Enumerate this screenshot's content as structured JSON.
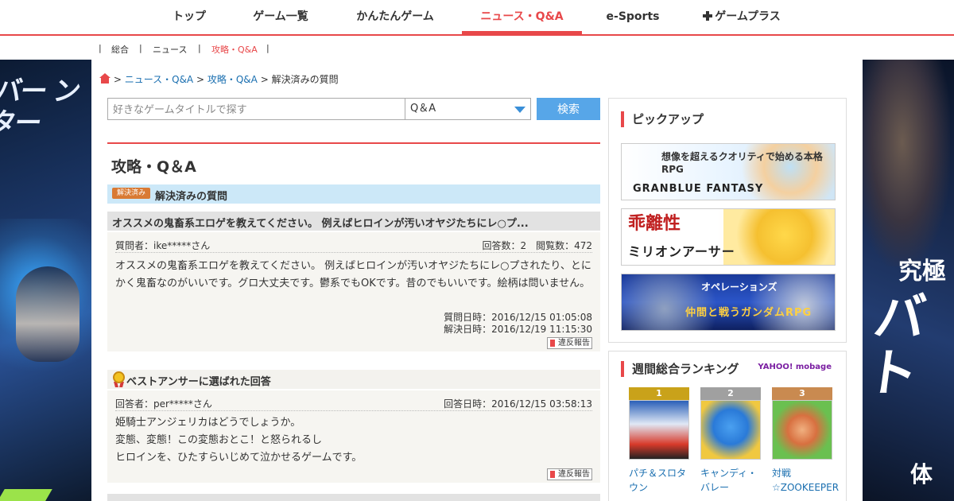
{
  "topnav": {
    "items": [
      "トップ",
      "ゲーム一覧",
      "かんたんゲーム",
      "ニュース・Q&A",
      "e-Sports",
      "ゲームプラス"
    ],
    "active_index": 3
  },
  "subnav": {
    "items": [
      "総合",
      "ニュース",
      "攻略・Q&A"
    ],
    "active_index": 2,
    "separator": "|"
  },
  "breadcrumb": {
    "sep": ">",
    "items": [
      "ニュース・Q&A",
      "攻略・Q&A",
      "解決済みの質問"
    ]
  },
  "search": {
    "placeholder": "好きなゲームタイトルで探す",
    "category_value": "Q＆A",
    "button_label": "検索"
  },
  "section_title": "攻略・Q＆A",
  "resolved": {
    "badge": "解決済み",
    "title": "解決済みの質問"
  },
  "question": {
    "title": "オススメの鬼畜系エロゲを教えてください。 例えばヒロインが汚いオヤジたちにレ○プ...",
    "asker": "質問者：ike*****さん",
    "counts": "回答数：2　閲覧数：472",
    "body": "オススメの鬼畜系エロゲを教えてください。 例えばヒロインが汚いオヤジたちにレ○プされたり、とにかく鬼畜なのがいいです。グロ大丈夫です。鬱系でもOKです。昔のでもいいです。絵柄は問いません。",
    "asked_at": "質問日時：2016/12/15 01:05:08",
    "resolved_at": "解決日時：2016/12/19 11:15:30",
    "report_label": "違反報告"
  },
  "best_answer": {
    "heading": "ベストアンサーに選ばれた回答",
    "answerer": "回答者：per*****さん",
    "answered_at": "回答日時：2016/12/15 03:58:13",
    "lines": [
      "姫騎士アンジェリカはどうでしょうか。",
      "変態、変態！この変態おとこ！と怒られるし",
      "ヒロインを、ひたすらいじめて泣かせるゲームです。"
    ],
    "report_label": "違反報告"
  },
  "pickup": {
    "heading": "ピックアップ",
    "banners": [
      {
        "text": "想像を超えるクオリティで始める本格RPG",
        "name": "GRANBLUE FANTASY"
      },
      {
        "text": "乖離性",
        "name": "ミリオンアーサー"
      },
      {
        "text": "オペレーションズ",
        "name": "仲間と戦うガンダムRPG"
      }
    ]
  },
  "ranking": {
    "heading": "週間総合ランキング",
    "provider": "YAHOO! mobage",
    "items": [
      {
        "rank": "1",
        "name": "パチ＆スロタウン",
        "color": "#c9a21a"
      },
      {
        "rank": "2",
        "name": "キャンディ・バレー",
        "color": "#a0a0a0"
      },
      {
        "rank": "3",
        "name": "対戦☆ZOOKEEPER",
        "color": "#c98a50"
      }
    ]
  },
  "banner_ads": {
    "left_text": "バー ンター",
    "right_text_1": "究極",
    "right_text_2": "バト",
    "right_text_3": "体"
  },
  "colors": {
    "accent": "#e8484a",
    "link": "#1a6fb0",
    "search_button": "#57a6e8"
  }
}
